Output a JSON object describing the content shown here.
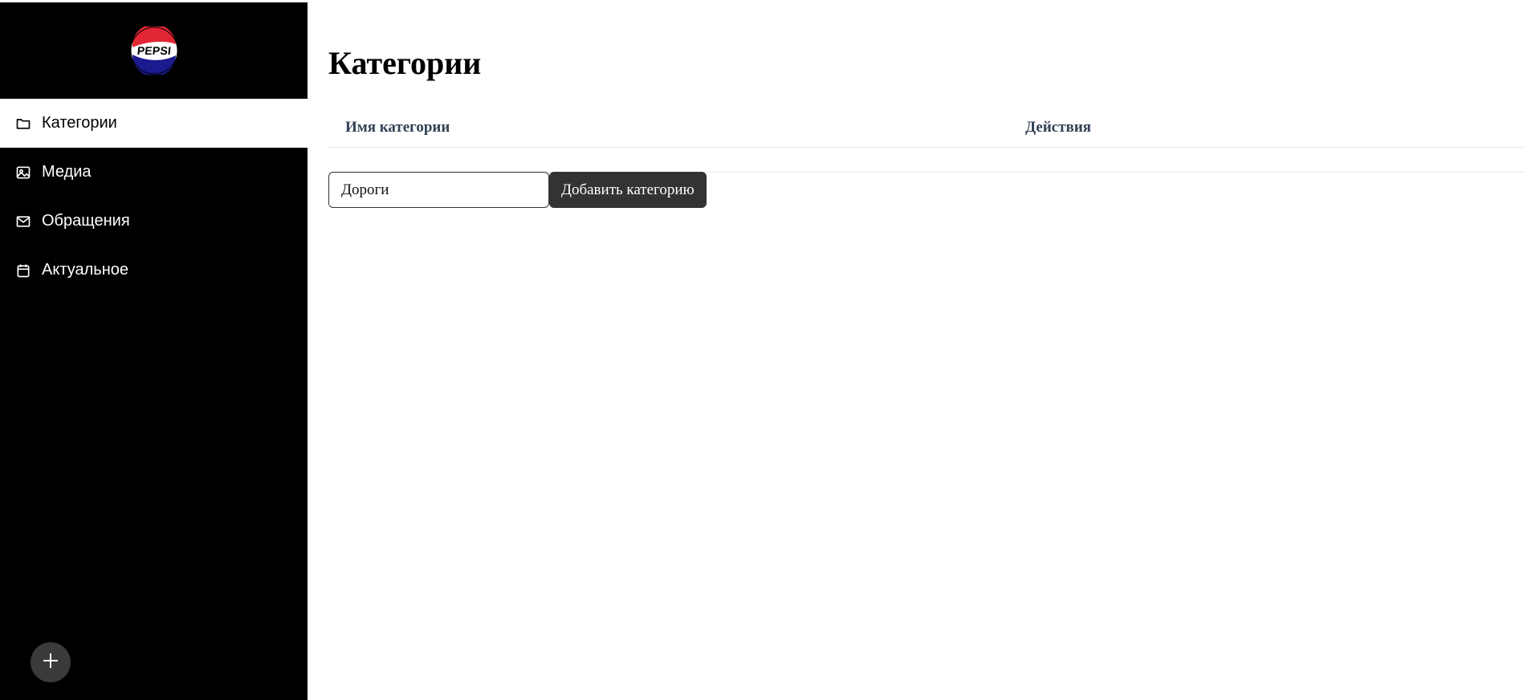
{
  "sidebar": {
    "logo_text": "PEPSI",
    "items": [
      {
        "label": "Категории",
        "icon": "folder-icon",
        "active": true
      },
      {
        "label": "Медиа",
        "icon": "image-icon",
        "active": false
      },
      {
        "label": "Обращения",
        "icon": "mail-icon",
        "active": false
      },
      {
        "label": "Актуальное",
        "icon": "calendar-icon",
        "active": false
      }
    ],
    "fab_icon": "plus-icon"
  },
  "main": {
    "title": "Категории",
    "table": {
      "columns": [
        "Имя категории",
        "Действия"
      ],
      "rows": []
    },
    "add_form": {
      "input_value": "Дороги",
      "button_label": "Добавить категорию"
    }
  },
  "colors": {
    "sidebar_bg": "#000000",
    "active_item_bg": "#ffffff",
    "button_bg": "#333333",
    "fab_bg": "#3a3a3a",
    "header_text": "#334155",
    "pepsi_red": "#e32636",
    "pepsi_blue": "#1b1b8f"
  }
}
